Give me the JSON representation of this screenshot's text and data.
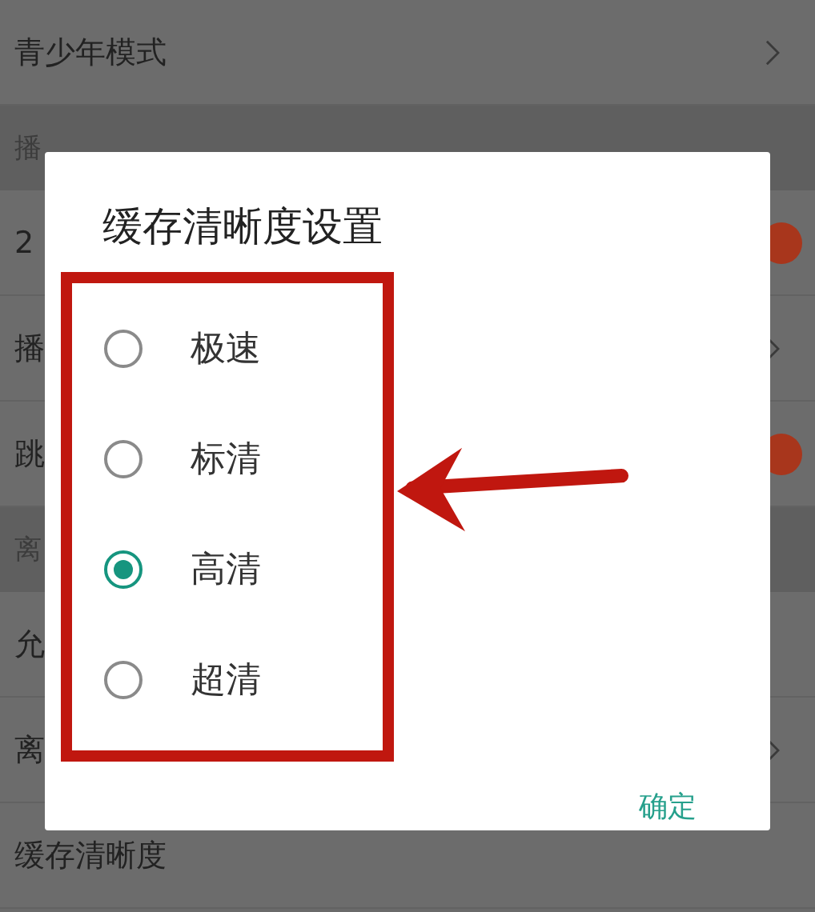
{
  "background_rows": [
    {
      "kind": "chevron-row",
      "label": "青少年模式"
    },
    {
      "kind": "header",
      "label": "播"
    },
    {
      "kind": "toggle-row",
      "label": "2",
      "on": true
    },
    {
      "kind": "chevron-row",
      "label": "播"
    },
    {
      "kind": "toggle-row",
      "label": "跳",
      "on": true
    },
    {
      "kind": "header",
      "label": "离"
    },
    {
      "kind": "row",
      "label": "允"
    },
    {
      "kind": "chevron-row",
      "label": "离"
    },
    {
      "kind": "row",
      "label": "缓存清晰度"
    }
  ],
  "dialog": {
    "title": "缓存清晰度设置",
    "options": [
      {
        "label": "极速",
        "selected": false
      },
      {
        "label": "标清",
        "selected": false
      },
      {
        "label": "高清",
        "selected": true
      },
      {
        "label": "超清",
        "selected": false
      }
    ],
    "confirm_button": "确定"
  }
}
